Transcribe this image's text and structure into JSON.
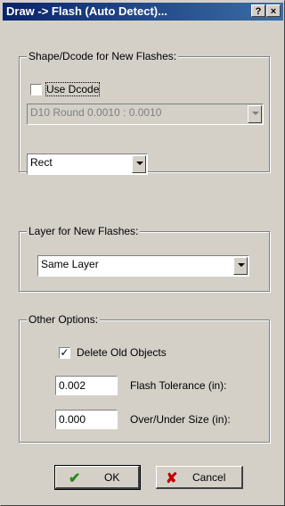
{
  "window": {
    "title": "Draw -> Flash (Auto Detect)...",
    "help_label": "?",
    "close_label": "×"
  },
  "shape_group": {
    "legend": "Shape/Dcode for New Flashes:",
    "use_dcode_checked": false,
    "use_dcode_label": "Use Dcode",
    "dcode_value": "D10   Round   0.0010 : 0.0010",
    "shape_value": "Rect"
  },
  "layer_group": {
    "legend": "Layer for New Flashes:",
    "layer_value": "Same Layer"
  },
  "options_group": {
    "legend": "Other Options:",
    "delete_old_checked": true,
    "delete_old_label": "Delete Old Objects",
    "flash_tolerance_value": "0.002",
    "flash_tolerance_label": "Flash Tolerance (in):",
    "over_under_value": "0.000",
    "over_under_label": "Over/Under Size (in):"
  },
  "buttons": {
    "ok_label": "OK",
    "cancel_label": "Cancel",
    "ok_icon": "checkmark-icon",
    "cancel_icon": "cross-icon"
  },
  "colors": {
    "titlebar_start": "#0a246a",
    "titlebar_end": "#3a6ea5",
    "face": "#d4d0c8",
    "ok_icon": "#2a8a1a",
    "cancel_icon": "#c00000"
  }
}
